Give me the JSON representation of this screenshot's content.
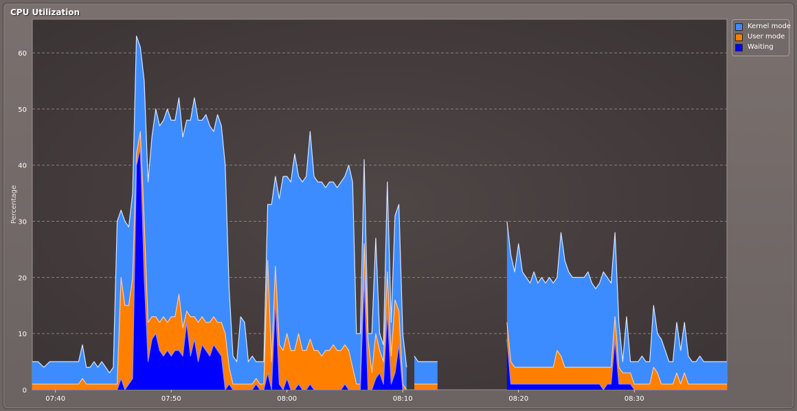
{
  "window": {
    "title": "CPU Utilization"
  },
  "chart_data": {
    "type": "area",
    "title": "CPU Utilization",
    "xlabel": "",
    "ylabel": "Percentage",
    "stacked": true,
    "grid": true,
    "legend_position": "top-right",
    "x_ticks": [
      "07:40",
      "07:50",
      "08:00",
      "08:10",
      "08:20",
      "08:30"
    ],
    "y_ticks": [
      0,
      10,
      20,
      30,
      40,
      50,
      60
    ],
    "ylim": [
      0,
      66
    ],
    "xlim": [
      "07:38",
      "08:38"
    ],
    "colors": {
      "kernel": "#3d8cff",
      "user": "#ff8000",
      "waiting": "#0000ff",
      "outline": "#d9e4ff"
    },
    "series": [
      {
        "name": "Kernel mode",
        "points": []
      },
      {
        "name": "User mode",
        "points": []
      },
      {
        "name": "Waiting",
        "points": []
      }
    ],
    "segments": [
      {
        "start": "07:38",
        "end": "08:11",
        "points": [
          [
            "07:38",
            5,
            1,
            0
          ],
          [
            "07:38:30",
            5,
            1,
            0
          ],
          [
            "07:39",
            4,
            1,
            0
          ],
          [
            "07:39:30",
            5,
            1,
            0
          ],
          [
            "07:40",
            5,
            1,
            0
          ],
          [
            "07:40:30",
            5,
            1,
            0
          ],
          [
            "07:41",
            5,
            1,
            0
          ],
          [
            "07:41:30",
            5,
            1,
            0
          ],
          [
            "07:42",
            5,
            2,
            0
          ],
          [
            "07:42:30",
            5,
            1,
            0
          ],
          [
            "07:43",
            5,
            1,
            0
          ],
          [
            "07:43:30",
            5,
            1,
            0
          ],
          [
            "07:44",
            4,
            1,
            0
          ],
          [
            "07:44:30",
            5,
            1,
            0
          ],
          [
            "07:45",
            3,
            1,
            0
          ],
          [
            "07:45:30",
            5,
            1,
            0
          ],
          [
            "07:46",
            10,
            1,
            0
          ],
          [
            "07:46:30",
            10,
            22,
            3
          ],
          [
            "07:47",
            15,
            15,
            1
          ],
          [
            "07:47:30",
            15,
            15,
            2
          ],
          [
            "07:48",
            15,
            19,
            11
          ],
          [
            "07:48:30",
            17,
            18,
            43
          ],
          [
            "07:49",
            17,
            18,
            44
          ],
          [
            "07:49:30",
            22,
            25,
            18
          ],
          [
            "07:50",
            37,
            12,
            6
          ],
          [
            "07:50:30",
            44,
            12,
            6
          ],
          [
            "07:51",
            35,
            13,
            10
          ],
          [
            "07:51:30",
            32,
            14,
            7
          ],
          [
            "07:52",
            32,
            14,
            6
          ],
          [
            "07:52:30",
            34,
            13,
            6
          ],
          [
            "07:53",
            33,
            15,
            6
          ],
          [
            "07:53:30",
            36,
            13,
            7
          ],
          [
            "07:54",
            35,
            16,
            7
          ],
          [
            "07:54:30",
            34,
            17,
            6
          ],
          [
            "07:55",
            32,
            12,
            13
          ],
          [
            "07:55:30",
            36,
            14,
            7
          ],
          [
            "07:56",
            34,
            13,
            8
          ],
          [
            "07:56:30",
            33,
            13,
            5
          ],
          [
            "07:57",
            33,
            12,
            8
          ],
          [
            "07:57:30",
            35,
            12,
            7
          ],
          [
            "07:58",
            34,
            12,
            6
          ],
          [
            "07:58:30",
            34,
            12,
            8
          ],
          [
            "07:59",
            36,
            12,
            7
          ],
          [
            "07:59:30",
            33,
            12,
            7
          ],
          [
            "08:00",
            30,
            12,
            7
          ],
          [
            "08:00:30",
            16,
            1,
            1
          ],
          [
            "08:01",
            9,
            1,
            1
          ],
          [
            "08:01:30",
            5,
            1,
            0
          ],
          [
            "08:02",
            5,
            1,
            0
          ],
          [
            "08:02:30",
            11,
            1,
            1
          ],
          [
            "08:03",
            11,
            1,
            1
          ],
          [
            "08:03:30",
            4,
            1,
            0
          ],
          [
            "08:04",
            4,
            1,
            0
          ],
          [
            "08:04:30",
            4,
            1,
            1
          ],
          [
            "08:05",
            4,
            1,
            0
          ],
          [
            "08:05:30",
            3,
            1,
            1
          ],
          [
            "08:06",
            5,
            0,
            0
          ],
          [
            "08:06:30",
            5,
            0,
            0
          ],
          [
            "08:07",
            3,
            1,
            2
          ],
          [
            "08:07:30",
            10,
            1,
            2
          ],
          [
            "08:08",
            14,
            10,
            3
          ],
          [
            "08:08:30",
            15,
            10,
            3
          ],
          [
            "08:09",
            15,
            8,
            0
          ],
          [
            "08:09:30",
            15,
            20,
            14
          ],
          [
            "08:10",
            23,
            16,
            0
          ],
          [
            "08:10:30",
            20,
            7,
            0
          ],
          [
            "08:11",
            33,
            0,
            0
          ]
        ]
      },
      {
        "start": "07:59",
        "end": "08:11",
        "points": []
      }
    ],
    "area_points": [
      {
        "x": "07:38",
        "kernel": 5,
        "user": 1,
        "waiting": 0
      },
      {
        "x": "07:39",
        "kernel": 4,
        "user": 1,
        "waiting": 0
      },
      {
        "x": "07:40",
        "kernel": 5,
        "user": 1,
        "waiting": 0
      },
      {
        "x": "07:41",
        "kernel": 5,
        "user": 1,
        "waiting": 0
      },
      {
        "x": "07:42",
        "kernel": 5,
        "user": 1,
        "waiting": 0
      },
      {
        "x": "07:42:30",
        "kernel": 7,
        "user": 2,
        "waiting": 0
      },
      {
        "x": "07:43",
        "kernel": 3,
        "user": 1,
        "waiting": 0
      },
      {
        "x": "07:44",
        "kernel": 4,
        "user": 1,
        "waiting": 0
      },
      {
        "x": "07:44:30",
        "kernel": 3,
        "user": 1,
        "waiting": 0
      },
      {
        "x": "07:45",
        "kernel": 4,
        "user": 1,
        "waiting": 0
      },
      {
        "x": "07:45:30",
        "kernel": 3,
        "user": 0,
        "waiting": 0
      },
      {
        "x": "07:46",
        "kernel": 4,
        "user": 0,
        "waiting": 0
      },
      {
        "x": "07:46:30",
        "kernel": 3,
        "user": 1,
        "waiting": 0
      },
      {
        "x": "07:47",
        "kernel": 3,
        "user": 0,
        "waiting": 0
      },
      {
        "x": "07:47:30",
        "kernel": 2,
        "user": 0,
        "waiting": 0
      },
      {
        "x": "07:48",
        "kernel": 2,
        "user": 0,
        "waiting": 0
      },
      {
        "x": "07:48:30",
        "kernel": 2,
        "user": 0,
        "waiting": 0
      },
      {
        "x": "07:49",
        "kernel": 2,
        "user": 0,
        "waiting": 0
      },
      {
        "x": "07:49:30",
        "kernel": 2,
        "user": 0,
        "waiting": 0
      },
      {
        "x": "07:50",
        "kernel": 2,
        "user": 0,
        "waiting": 0
      }
    ]
  },
  "legend": {
    "items": [
      {
        "label": "Kernel mode",
        "color": "#3d8cff"
      },
      {
        "label": "User mode",
        "color": "#ff8000"
      },
      {
        "label": "Waiting",
        "color": "#0000ff"
      }
    ]
  }
}
